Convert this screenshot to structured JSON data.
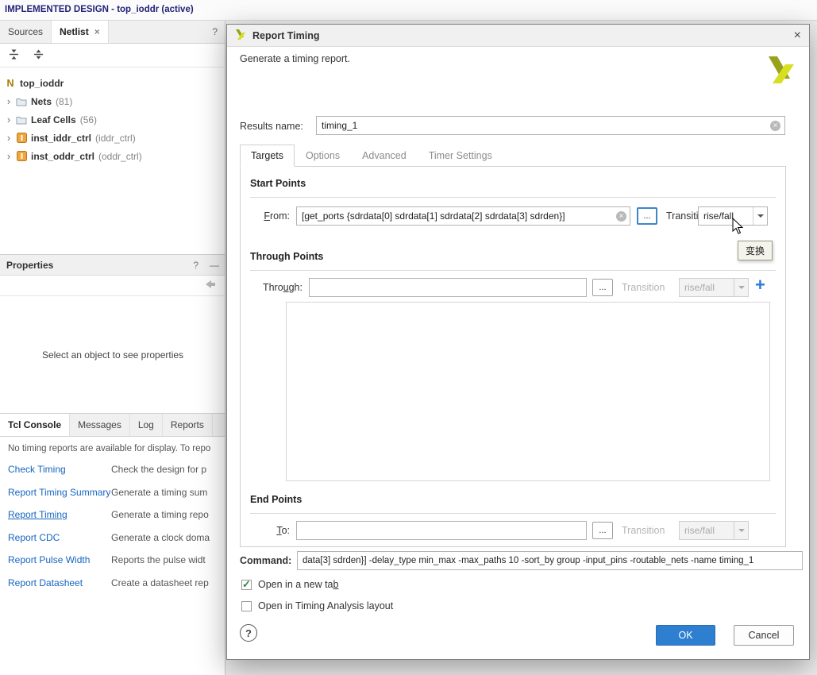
{
  "colors": {
    "accent": "#2e7fd0",
    "link": "#1565c0",
    "logo_light": "#d7df23",
    "logo_dark": "#9aa11a"
  },
  "topbar": {
    "text": "IMPLEMENTED DESIGN - top_ioddr (active)"
  },
  "sources": {
    "tab_sources": "Sources",
    "tab_netlist": "Netlist",
    "close": "×",
    "help": "?",
    "tree": [
      {
        "icon": "N",
        "name": "top_ioddr",
        "suffix": ""
      },
      {
        "name": "Nets",
        "suffix": "(81)"
      },
      {
        "name": "Leaf Cells",
        "suffix": "(56)"
      },
      {
        "name": "inst_iddr_ctrl",
        "suffix": "(iddr_ctrl)"
      },
      {
        "name": "inst_oddr_ctrl",
        "suffix": "(oddr_ctrl)"
      }
    ]
  },
  "properties": {
    "title": "Properties",
    "help": "?",
    "float": "—",
    "empty": "Select an object to see properties"
  },
  "console": {
    "tabs": [
      "Tcl Console",
      "Messages",
      "Log",
      "Reports"
    ],
    "notice": "No timing reports are available for display. To repo",
    "rows": [
      {
        "link": "Check Timing",
        "desc": "Check the design for p"
      },
      {
        "link": "Report Timing Summary",
        "desc": "Generate a timing sum"
      },
      {
        "link": "Report Timing",
        "desc": "Generate a timing repo"
      },
      {
        "link": "Report CDC",
        "desc": "Generate a clock doma"
      },
      {
        "link": "Report Pulse Width",
        "desc": "Reports the pulse widt"
      },
      {
        "link": "Report Datasheet",
        "desc": "Create a datasheet rep"
      }
    ]
  },
  "dialog": {
    "title": "Report Timing",
    "close": "×",
    "subtitle": "Generate a timing report.",
    "results_label": "Results name:",
    "results_value": "timing_1",
    "tabs": [
      "Targets",
      "Options",
      "Advanced",
      "Timer Settings"
    ],
    "start": {
      "heading": "Start Points",
      "label_u": "F",
      "label_rest": "rom:",
      "value": "[get_ports {sdrdata[0] sdrdata[1] sdrdata[2] sdrdata[3] sdrden}]",
      "browse": "...",
      "transition": "Transition",
      "transition_value": "rise/fall"
    },
    "tooltip": "变换",
    "through": {
      "heading": "Through Points",
      "label_pre": "Thro",
      "label_u": "u",
      "label_rest": "gh:",
      "browse": "...",
      "transition": "Transition",
      "transition_value": "rise/fall",
      "add": "+"
    },
    "end": {
      "heading": "End Points",
      "label_u": "T",
      "label_rest": "o:",
      "browse": "...",
      "transition": "Transition",
      "transition_value": "rise/fall"
    },
    "command_label": "Command:",
    "command_value": "data[3] sdrden}] -delay_type min_max -max_paths 10 -sort_by group -input_pins -routable_nets -name timing_1",
    "open_tab_pre": "Open in a new ta",
    "open_tab_u": "b",
    "open_layout": "Open in Timing Analysis layout",
    "help": "?",
    "ok": "OK",
    "cancel": "Cancel"
  }
}
